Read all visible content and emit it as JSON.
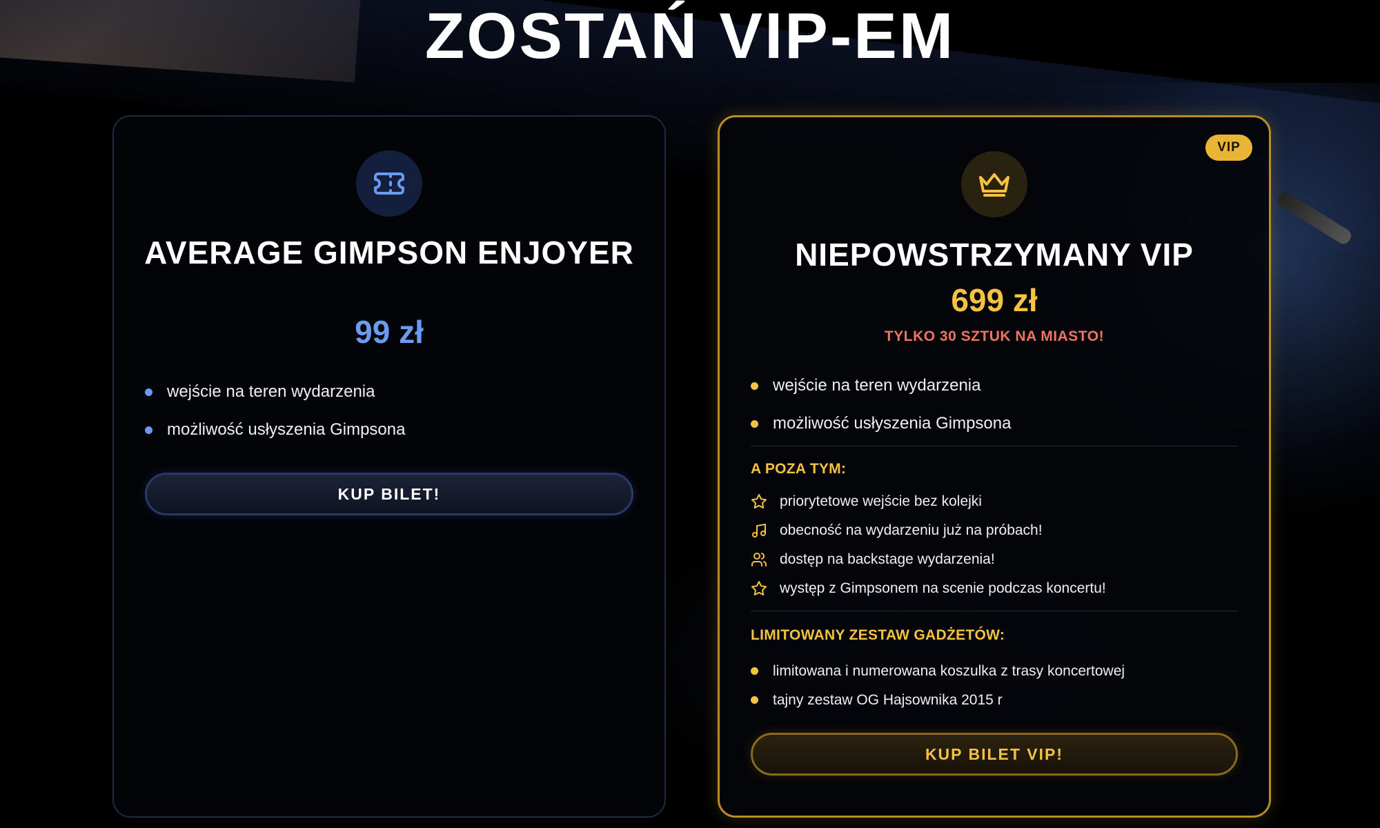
{
  "page": {
    "title": "ZOSTAŃ VIP-EM"
  },
  "plans": {
    "basic": {
      "icon": "ticket-icon",
      "name": "AVERAGE GIMPSON ENJOYER",
      "price": "99 zł",
      "features": [
        "wejście na teren wydarzenia",
        "możliwość usłyszenia Gimpsona"
      ],
      "cta_label": "KUP BILET!",
      "accent": "#6b9bf0"
    },
    "vip": {
      "badge": "VIP",
      "icon": "crown-icon",
      "name": "NIEPOWSTRZYMANY VIP",
      "price": "699 zł",
      "limited_note": "TYLKO 30 SZTUK NA MIASTO!",
      "features": [
        "wejście na teren wydarzenia",
        "możliwość usłyszenia Gimpsona"
      ],
      "extras_label": "A POZA TYM:",
      "extras": [
        {
          "icon": "star-icon",
          "text": "priorytetowe wejście bez kolejki"
        },
        {
          "icon": "music-note-icon",
          "text": "obecność na wydarzeniu już na próbach!"
        },
        {
          "icon": "users-icon",
          "text": "dostęp na backstage wydarzenia!"
        },
        {
          "icon": "star-icon",
          "text": "występ z Gimpsonem na scenie podczas koncertu!"
        }
      ],
      "gadgets_label": "LIMITOWANY ZESTAW GADŻETÓW:",
      "gadgets": [
        "limitowana i numerowana koszulka z trasy koncertowej",
        "tajny zestaw OG Hajsownika 2015 r"
      ],
      "cta_label": "KUP BILET VIP!",
      "accent": "#f5c242",
      "note_color": "#f07464"
    }
  }
}
